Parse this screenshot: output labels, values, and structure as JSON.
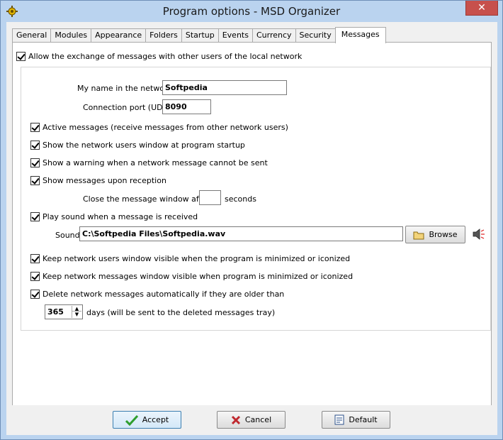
{
  "window": {
    "title": "Program options - MSD Organizer",
    "close_label": "✕"
  },
  "tabs": [
    {
      "label": "General"
    },
    {
      "label": "Modules"
    },
    {
      "label": "Appearance"
    },
    {
      "label": "Folders"
    },
    {
      "label": "Startup"
    },
    {
      "label": "Events"
    },
    {
      "label": "Currency"
    },
    {
      "label": "Security"
    },
    {
      "label": "Messages"
    }
  ],
  "active_tab": "Messages",
  "messages": {
    "allow_exchange": {
      "label": "Allow the exchange of messages with other users of the local network",
      "checked": true
    },
    "my_name_label": "My name in the network",
    "my_name_value": "Softpedia",
    "port_label": "Connection port (UDP)",
    "port_value": "8090",
    "active_messages": {
      "label": "Active messages (receive messages from other network users)",
      "checked": true
    },
    "show_users_window": {
      "label": "Show the network users window at program startup",
      "checked": true
    },
    "show_warning": {
      "label": "Show a warning when a network message cannot be sent",
      "checked": true
    },
    "show_upon_reception": {
      "label": "Show messages upon reception",
      "checked": true
    },
    "close_after_label": "Close the message window after",
    "close_after_value": "",
    "seconds_label": "seconds",
    "play_sound": {
      "label": "Play sound when a message is received",
      "checked": true
    },
    "sound_label": "Sound",
    "sound_value": "C:\\Softpedia Files\\Softpedia.wav",
    "browse_label": "Browse",
    "keep_users_visible": {
      "label": "Keep network users window visible when the program is minimized or iconized",
      "checked": true
    },
    "keep_messages_visible": {
      "label": "Keep network messages window visible when program is minimized or iconized",
      "checked": true
    },
    "delete_old": {
      "label": "Delete network messages automatically if they are older than",
      "checked": true
    },
    "days_value": "365",
    "days_label": "days (will be sent to the deleted messages tray)"
  },
  "buttons": {
    "accept": "Accept",
    "cancel": "Cancel",
    "default": "Default"
  },
  "colors": {
    "accent_green": "#2e9e2e",
    "cancel_red": "#c0282e",
    "titlebar": "#bad3ef"
  }
}
